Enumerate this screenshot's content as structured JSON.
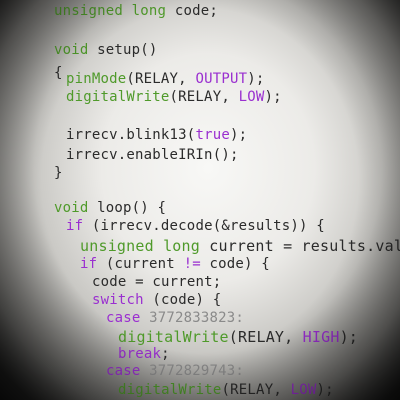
{
  "code_lines": [
    {
      "id": "l1",
      "parts": [
        {
          "t": "unsigned long",
          "c": "kw-green"
        },
        {
          "t": " code;"
        }
      ]
    },
    {
      "id": "l2",
      "parts": [
        {
          "t": "void",
          "c": "kw-green"
        },
        {
          "t": " setup()"
        }
      ]
    },
    {
      "id": "l3",
      "parts": [
        {
          "t": "{"
        }
      ]
    },
    {
      "id": "l4",
      "parts": [
        {
          "t": "pinMode",
          "c": "kw-green"
        },
        {
          "t": "(RELAY, "
        },
        {
          "t": "OUTPUT",
          "c": "kw-purple"
        },
        {
          "t": ");"
        }
      ]
    },
    {
      "id": "l5",
      "parts": [
        {
          "t": "digitalWrite",
          "c": "kw-green"
        },
        {
          "t": "(RELAY, "
        },
        {
          "t": "LOW",
          "c": "kw-purple"
        },
        {
          "t": ");"
        }
      ]
    },
    {
      "id": "l6",
      "parts": [
        {
          "t": "irrecv.blink13("
        },
        {
          "t": "true",
          "c": "kw-purple"
        },
        {
          "t": ");"
        }
      ]
    },
    {
      "id": "l7",
      "parts": [
        {
          "t": "irrecv.enableIRIn();"
        }
      ]
    },
    {
      "id": "l8",
      "parts": [
        {
          "t": "}"
        }
      ]
    },
    {
      "id": "l9",
      "parts": [
        {
          "t": "void",
          "c": "kw-green"
        },
        {
          "t": " loop() {"
        }
      ]
    },
    {
      "id": "l10",
      "parts": [
        {
          "t": "if",
          "c": "kw-purple"
        },
        {
          "t": " (irrecv.decode(&results)) {"
        }
      ]
    },
    {
      "id": "l11",
      "parts": [
        {
          "t": "unsigned long",
          "c": "kw-green"
        },
        {
          "t": " current = results.value;"
        }
      ]
    },
    {
      "id": "l12",
      "parts": [
        {
          "t": "if",
          "c": "kw-purple"
        },
        {
          "t": " (current "
        },
        {
          "t": "!=",
          "c": "kw-purple"
        },
        {
          "t": " code) {"
        }
      ]
    },
    {
      "id": "l13",
      "parts": [
        {
          "t": "code = current;"
        }
      ]
    },
    {
      "id": "l14",
      "parts": [
        {
          "t": "switch",
          "c": "kw-purple"
        },
        {
          "t": " (code) {"
        }
      ]
    },
    {
      "id": "l15",
      "parts": [
        {
          "t": "case",
          "c": "kw-purple"
        },
        {
          "t": " 3772833823:",
          "c": "num"
        }
      ]
    },
    {
      "id": "l16",
      "parts": [
        {
          "t": "digitalWrite",
          "c": "kw-green"
        },
        {
          "t": "(RELAY, "
        },
        {
          "t": "HIGH",
          "c": "kw-purple"
        },
        {
          "t": ");"
        }
      ]
    },
    {
      "id": "l17",
      "parts": [
        {
          "t": "break",
          "c": "kw-purple"
        },
        {
          "t": ";"
        }
      ]
    },
    {
      "id": "l18",
      "parts": [
        {
          "t": "case",
          "c": "kw-purple"
        },
        {
          "t": " 3772829743:",
          "c": "num"
        }
      ]
    },
    {
      "id": "l19",
      "parts": [
        {
          "t": "digitalWrite",
          "c": "kw-green"
        },
        {
          "t": "(RELAY, "
        },
        {
          "t": "LOW",
          "c": "kw-purple"
        },
        {
          "t": ");"
        }
      ]
    }
  ]
}
